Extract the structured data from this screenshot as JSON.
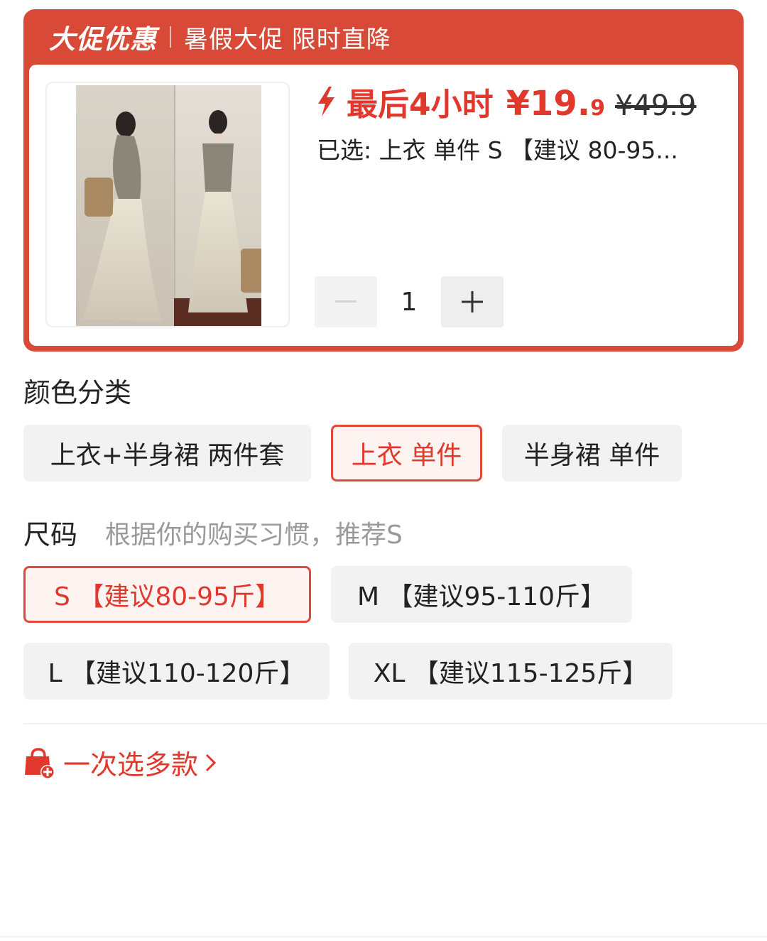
{
  "promo": {
    "brand": "大促优惠",
    "slogan": "暑假大促 限时直降"
  },
  "product": {
    "countdown": "最后4小时",
    "price_main": "¥19.",
    "price_fraction": "9",
    "original_price": "¥49.9",
    "selected_text": "已选: 上衣 单件 S 【建议 80-95...",
    "quantity": "1",
    "quantity_decrement_disabled": true,
    "image_alt": "product-photo"
  },
  "color_section": {
    "label": "颜色分类",
    "options": [
      "上衣+半身裙 两件套",
      "上衣 单件",
      "半身裙 单件"
    ],
    "selected_index": 1
  },
  "size_section": {
    "label": "尺码",
    "hint": "根据你的购买习惯，推荐S",
    "options": [
      "S 【建议80-95斤】",
      "M 【建议95-110斤】",
      "L 【建议110-120斤】",
      "XL 【建议115-125斤】"
    ],
    "selected_index": 0
  },
  "multi_select": {
    "label": "一次选多款",
    "icon": "shopping-bag-plus-icon"
  },
  "colors": {
    "accent": "#e0382c",
    "promo_bg": "#d84a37",
    "chip_bg": "#f2f2f2"
  }
}
